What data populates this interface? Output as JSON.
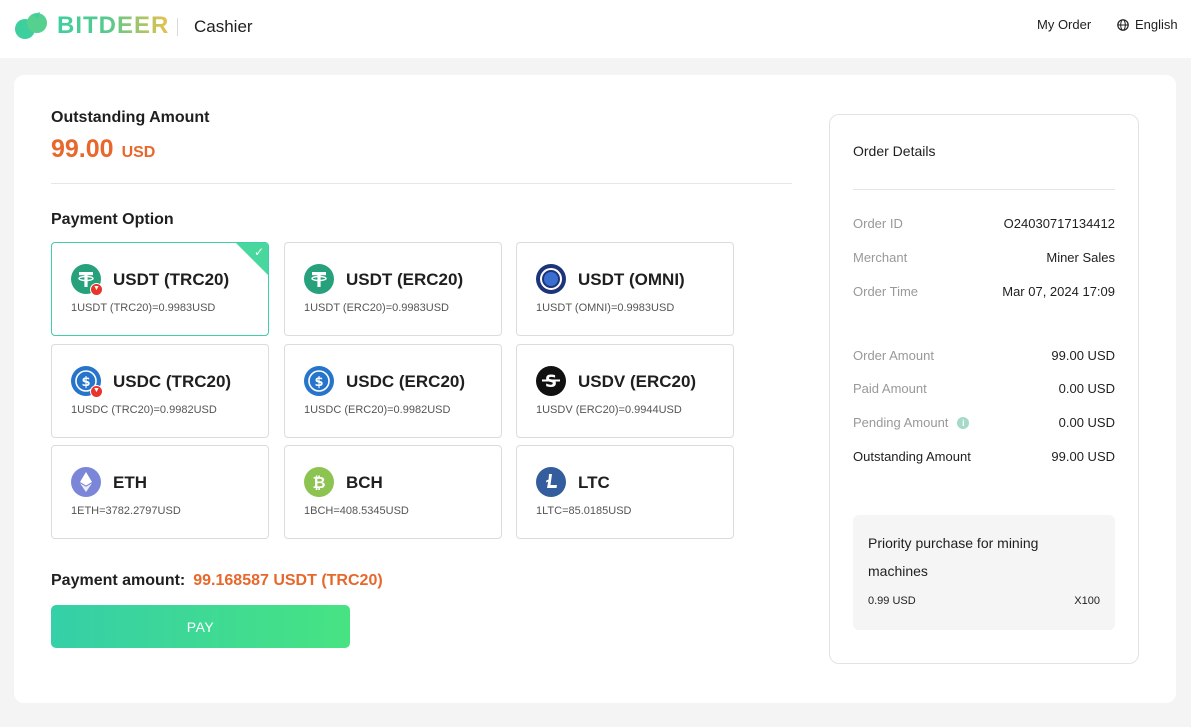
{
  "header": {
    "logo_text": "BITDEER",
    "title": "Cashier",
    "my_order": "My Order",
    "language": "English",
    "brand_colors": {
      "green": "#3ecf9f",
      "gold": "#e9c14a"
    }
  },
  "outstanding": {
    "label": "Outstanding Amount",
    "amount": "99.00",
    "currency": "USD"
  },
  "payment_option": {
    "label": "Payment Option",
    "selected": "USDT (TRC20)",
    "options": [
      {
        "name": "USDT (TRC20)",
        "rate": "1USDT (TRC20)=0.9983USD",
        "icon": "tether-icon",
        "tron_badge": true,
        "selected": true
      },
      {
        "name": "USDT (ERC20)",
        "rate": "1USDT (ERC20)=0.9983USD",
        "icon": "tether-icon",
        "tron_badge": false,
        "selected": false
      },
      {
        "name": "USDT (OMNI)",
        "rate": "1USDT (OMNI)=0.9983USD",
        "icon": "omni-icon",
        "tron_badge": false,
        "selected": false
      },
      {
        "name": "USDC (TRC20)",
        "rate": "1USDC (TRC20)=0.9982USD",
        "icon": "usdc-icon",
        "tron_badge": true,
        "selected": false
      },
      {
        "name": "USDC (ERC20)",
        "rate": "1USDC (ERC20)=0.9982USD",
        "icon": "usdc-icon",
        "tron_badge": false,
        "selected": false
      },
      {
        "name": "USDV (ERC20)",
        "rate": "1USDV (ERC20)=0.9944USD",
        "icon": "usdv-icon",
        "tron_badge": false,
        "selected": false
      },
      {
        "name": "ETH",
        "rate": "1ETH=3782.2797USD",
        "icon": "eth-icon",
        "tron_badge": false,
        "selected": false
      },
      {
        "name": "BCH",
        "rate": "1BCH=408.5345USD",
        "icon": "bch-icon",
        "tron_badge": false,
        "selected": false
      },
      {
        "name": "LTC",
        "rate": "1LTC=85.0185USD",
        "icon": "ltc-icon",
        "tron_badge": false,
        "selected": false
      }
    ]
  },
  "payment_amount": {
    "label": "Payment amount:",
    "value": "99.168587 USDT (TRC20)"
  },
  "pay_button": "PAY",
  "order_details": {
    "title": "Order Details",
    "order_id_label": "Order ID",
    "order_id": "O24030717134412",
    "merchant_label": "Merchant",
    "merchant": "Miner Sales",
    "order_time_label": "Order Time",
    "order_time": "Mar 07, 2024 17:09",
    "order_amount_label": "Order Amount",
    "order_amount": "99.00 USD",
    "paid_amount_label": "Paid Amount",
    "paid_amount": "0.00 USD",
    "pending_amount_label": "Pending Amount",
    "pending_amount": "0.00 USD",
    "outstanding_amount_label": "Outstanding Amount",
    "outstanding_amount": "99.00 USD"
  },
  "promo": {
    "title": "Priority purchase for mining machines",
    "price": "0.99 USD",
    "quantity": "X100"
  },
  "colors": {
    "accent_orange": "#e8672b",
    "selected_border": "#3ecfa6",
    "pay_gradient_start": "#35cfa8",
    "pay_gradient_end": "#47e382"
  }
}
